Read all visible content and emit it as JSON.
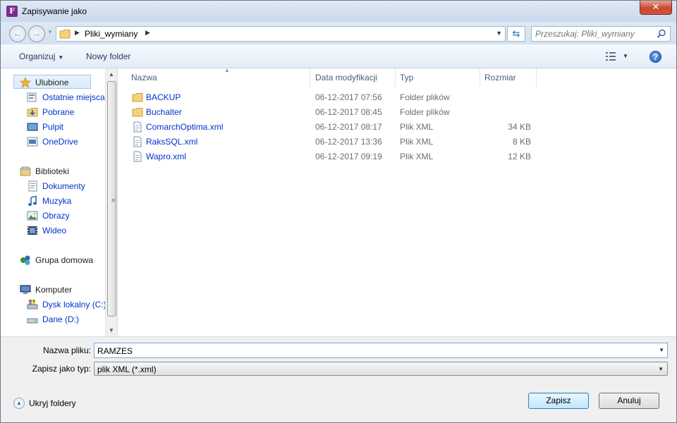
{
  "window": {
    "title": "Zapisywanie jako",
    "app_icon_letter": "F",
    "close_glyph": "✕"
  },
  "address": {
    "path_segment": "Pliki_wymiany"
  },
  "search": {
    "placeholder": "Przeszukaj: Pliki_wymiany"
  },
  "toolbar": {
    "organize_label": "Organizuj",
    "new_folder_label": "Nowy folder",
    "help_glyph": "?"
  },
  "navigation": {
    "favorites": {
      "label": "Ulubione",
      "icon": "star-icon",
      "items": [
        {
          "label": "Ostatnie miejsca",
          "icon": "recent-places-icon"
        },
        {
          "label": "Pobrane",
          "icon": "downloads-icon"
        },
        {
          "label": "Pulpit",
          "icon": "desktop-icon"
        },
        {
          "label": "OneDrive",
          "icon": "onedrive-icon"
        }
      ]
    },
    "libraries": {
      "label": "Biblioteki",
      "icon": "libraries-icon",
      "items": [
        {
          "label": "Dokumenty",
          "icon": "documents-icon"
        },
        {
          "label": "Muzyka",
          "icon": "music-icon"
        },
        {
          "label": "Obrazy",
          "icon": "pictures-icon"
        },
        {
          "label": "Wideo",
          "icon": "video-icon"
        }
      ]
    },
    "homegroup": {
      "label": "Grupa domowa",
      "icon": "homegroup-icon"
    },
    "computer": {
      "label": "Komputer",
      "icon": "computer-icon",
      "items": [
        {
          "label": "Dysk lokalny (C:)",
          "icon": "local-disk-icon"
        },
        {
          "label": "Dane (D:)",
          "icon": "drive-icon"
        }
      ]
    }
  },
  "file_list": {
    "columns": [
      "Nazwa",
      "Data modyfikacji",
      "Typ",
      "Rozmiar"
    ],
    "rows": [
      {
        "name": "BACKUP",
        "date": "06-12-2017 07:56",
        "type": "Folder plików",
        "size": "",
        "icon": "folder-icon"
      },
      {
        "name": "Buchalter",
        "date": "06-12-2017 08:45",
        "type": "Folder plików",
        "size": "",
        "icon": "folder-icon"
      },
      {
        "name": "ComarchOptima.xml",
        "date": "06-12-2017 08:17",
        "type": "Plik XML",
        "size": "34 KB",
        "icon": "xml-file-icon"
      },
      {
        "name": "RaksSQL.xml",
        "date": "06-12-2017 13:36",
        "type": "Plik XML",
        "size": "8 KB",
        "icon": "xml-file-icon"
      },
      {
        "name": "Wapro.xml",
        "date": "06-12-2017 09:19",
        "type": "Plik XML",
        "size": "12 KB",
        "icon": "xml-file-icon"
      }
    ]
  },
  "form": {
    "filename_label": "Nazwa pliku:",
    "filename_value": "RAMZES",
    "filetype_label": "Zapisz jako typ:",
    "filetype_value": "plik XML (*.xml)"
  },
  "footer": {
    "hide_folders_label": "Ukryj foldery",
    "save_label": "Zapisz",
    "cancel_label": "Anuluj"
  },
  "colors": {
    "link_blue": "#0033cc",
    "toolbar_text": "#1e395b",
    "close_red": "#c74a30"
  }
}
